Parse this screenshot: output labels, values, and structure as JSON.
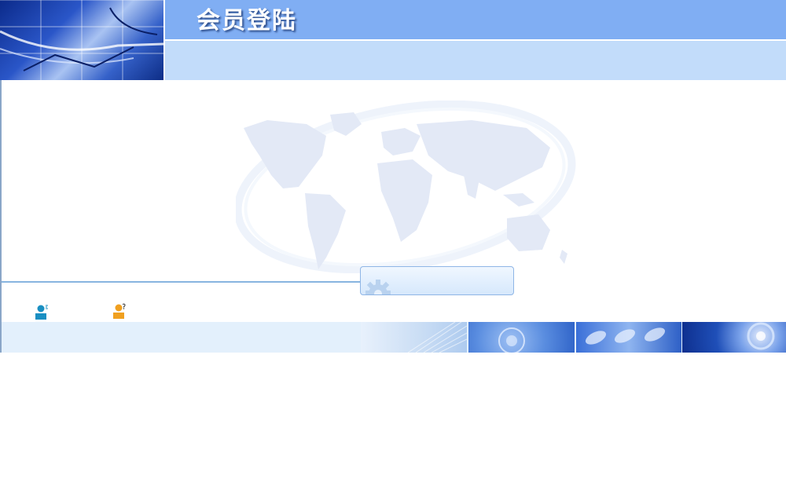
{
  "header": {
    "title": "会员登陆"
  },
  "colors": {
    "title_band": "#80aef3",
    "sub_band": "#c2dcfa",
    "footer_band": "#e3f0fc",
    "divider": "#87b4e0",
    "register_icon": "#1a8fc2",
    "forgot_icon": "#f0a020"
  },
  "icons": {
    "login_box": "gear-icon",
    "register": "user-register-icon",
    "forgot_password": "user-help-icon"
  }
}
